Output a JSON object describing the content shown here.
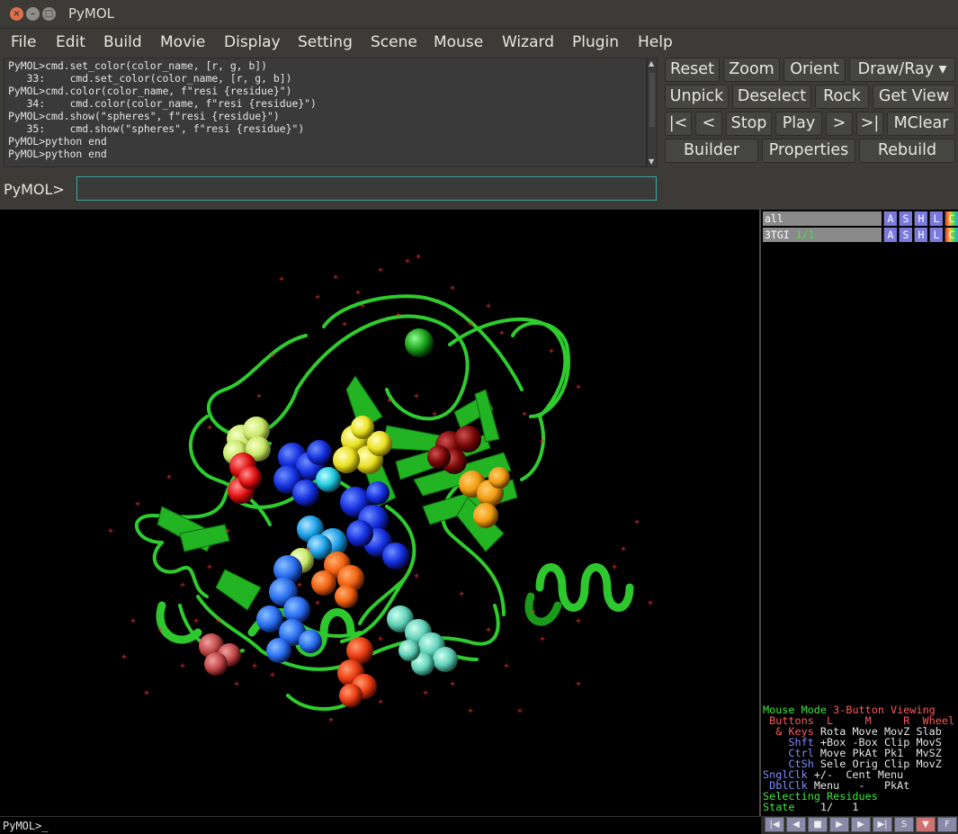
{
  "window": {
    "title": "PyMOL"
  },
  "menu": [
    "File",
    "Edit",
    "Build",
    "Movie",
    "Display",
    "Setting",
    "Scene",
    "Mouse",
    "Wizard",
    "Plugin",
    "Help"
  ],
  "log_lines": [
    "PyMOL>cmd.set_color(color_name, [r, g, b])",
    "   33:    cmd.set_color(color_name, [r, g, b])",
    "PyMOL>cmd.color(color_name, f\"resi {residue}\")",
    "   34:    cmd.color(color_name, f\"resi {residue}\")",
    "PyMOL>cmd.show(\"spheres\", f\"resi {residue}\")",
    "   35:    cmd.show(\"spheres\", f\"resi {residue}\")",
    "PyMOL>python end",
    "PyMOL>python end"
  ],
  "prompt": {
    "label": "PyMOL>",
    "value": ""
  },
  "buttons": {
    "reset": "Reset",
    "zoom": "Zoom",
    "orient": "Orient",
    "drawray": "Draw/Ray ▾",
    "unpick": "Unpick",
    "deselect": "Deselect",
    "rock": "Rock",
    "getview": "Get View",
    "first": "|<",
    "prev": "<",
    "stop": "Stop",
    "play": "Play",
    "next": ">",
    "last": ">|",
    "mclear": "MClear",
    "builder": "Builder",
    "properties": "Properties",
    "rebuild": "Rebuild"
  },
  "objects": [
    {
      "name": "all",
      "state": ""
    },
    {
      "name": "3TGI",
      "state": "1/1"
    }
  ],
  "obj_buttons": [
    "A",
    "S",
    "H",
    "L",
    "C"
  ],
  "mouse_info": {
    "mode_label": "Mouse Mode",
    "mode_value": "3-Button Viewing",
    "buttons_row": " Buttons  L     M     R  Wheel",
    "keys_row": "  & Keys",
    "keys_vals": " Rota Move MovZ Slab",
    "shft": "    Shft",
    "shft_vals": " +Box -Box Clip MovS",
    "ctrl": "    Ctrl",
    "ctrl_vals": " Move PkAt Pk1  MvSZ",
    "ctsh": "    CtSh",
    "ctsh_vals": " Sele Orig Clip MovZ",
    "sngl": "SnglClk",
    "sngl_vals": " +/-  Cent Menu",
    "dbl": " DblClk",
    "dbl_vals": " Menu   -   PkAt",
    "selecting": "Selecting Residues",
    "state_label": "State",
    "state_vals": "    1/   1"
  },
  "bottom_prompt": "PyMOL>_",
  "playbar": [
    "|◀",
    "◀",
    "■",
    "▶",
    "▶",
    "▶|",
    "S",
    "▼",
    "F"
  ]
}
